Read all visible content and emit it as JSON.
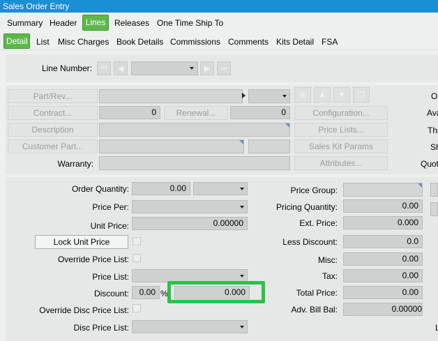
{
  "window": {
    "title": "Sales Order Entry"
  },
  "tabs_top": [
    {
      "label": "Summary",
      "active": false
    },
    {
      "label": "Header",
      "active": false
    },
    {
      "label": "Lines",
      "active": true
    },
    {
      "label": "Releases",
      "active": false
    },
    {
      "label": "One Time Ship To",
      "active": false
    }
  ],
  "tabs_sub": [
    {
      "label": "Detail",
      "active": true
    },
    {
      "label": "List",
      "active": false
    },
    {
      "label": "Misc Charges",
      "active": false
    },
    {
      "label": "Book Details",
      "active": false
    },
    {
      "label": "Commissions",
      "active": false
    },
    {
      "label": "Comments",
      "active": false
    },
    {
      "label": "Kits Detail",
      "active": false
    },
    {
      "label": "FSA",
      "active": false
    }
  ],
  "line_nav": {
    "label": "Line Number:",
    "value": ""
  },
  "detail": {
    "part_rev_btn": "Part/Rev...",
    "contract_btn": "Contract...",
    "contract_value": "0",
    "renewal_btn": "Renewal...",
    "renewal_value": "0",
    "description_btn": "Description",
    "customer_part_btn": "Customer Part...",
    "warranty_label": "Warranty:",
    "configuration_btn": "Configuration...",
    "price_lists_btn": "Price Lists...",
    "sales_kit_params_btn": "Sales Kit Params",
    "attributes_btn": "Attributes...",
    "right_cut_labels": [
      "Or",
      "Ava",
      "Thi",
      "Sh",
      "Quot"
    ]
  },
  "pricing": {
    "order_quantity_label": "Order Quantity:",
    "order_quantity_value": "0.00",
    "price_per_label": "Price Per:",
    "unit_price_label": "Unit Price:",
    "unit_price_value": "0.00000",
    "lock_unit_price_btn": "Lock Unit Price",
    "override_price_list_label": "Override Price List:",
    "price_list_label": "Price List:",
    "discount_label": "Discount:",
    "discount_pct_value": "0.00",
    "discount_pct_symbol": "%",
    "discount_amount_value": "0.000",
    "override_disc_price_list_label": "Override Disc Price List:",
    "disc_price_list_label": "Disc Price List:",
    "price_group_label": "Price Group:",
    "pricing_quantity_label": "Pricing Quantity:",
    "pricing_quantity_value": "0.00",
    "ext_price_label": "Ext. Price:",
    "ext_price_value": "0.000",
    "less_discount_label": "Less Discount:",
    "less_discount_value": "0.0",
    "misc_label": "Misc:",
    "misc_value": "0.00",
    "tax_label": "Tax:",
    "tax_value": "0.00",
    "total_price_label": "Total Price:",
    "total_price_value": "0.00",
    "adv_bill_bal_label": "Adv. Bill Bal:",
    "adv_bill_bal_value": "0.00000",
    "right_cut_label": "L"
  },
  "colors": {
    "accent": "#5db84c",
    "titlebar": "#1a8fd4",
    "highlight": "#2ac24a"
  }
}
